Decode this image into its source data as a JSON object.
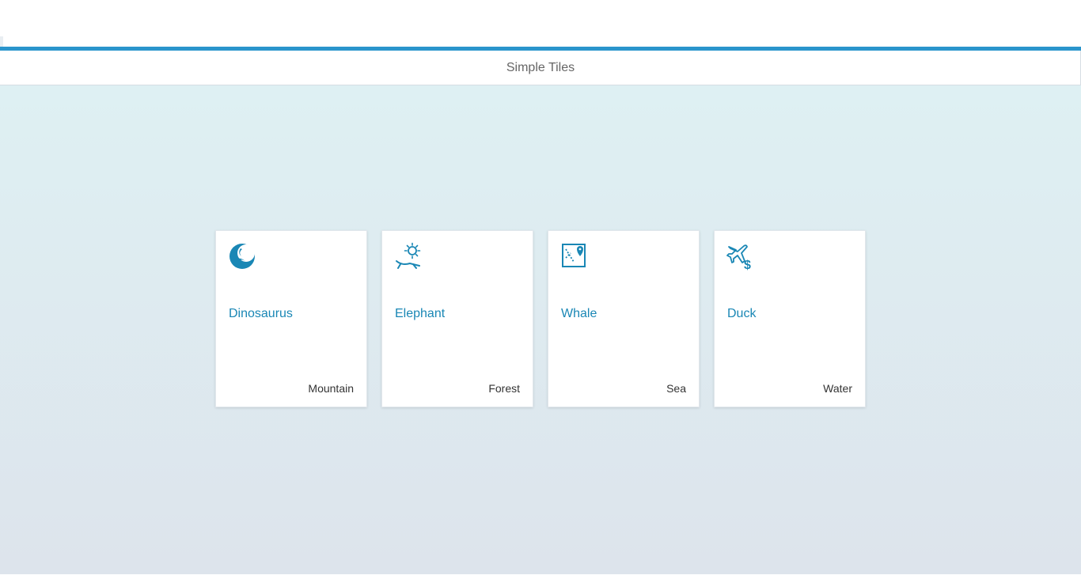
{
  "page": {
    "title": "Simple Tiles"
  },
  "colors": {
    "accent": "#2a95cc",
    "tile_title": "#1a87b5",
    "icon": "#1a87b5"
  },
  "tiles": [
    {
      "title": "Dinosaurus",
      "footer": "Mountain",
      "icon": "moon-crescent-icon"
    },
    {
      "title": "Elephant",
      "footer": "Forest",
      "icon": "sun-lounger-icon"
    },
    {
      "title": "Whale",
      "footer": "Sea",
      "icon": "map-pin-icon"
    },
    {
      "title": "Duck",
      "footer": "Water",
      "icon": "plane-dollar-icon"
    }
  ]
}
